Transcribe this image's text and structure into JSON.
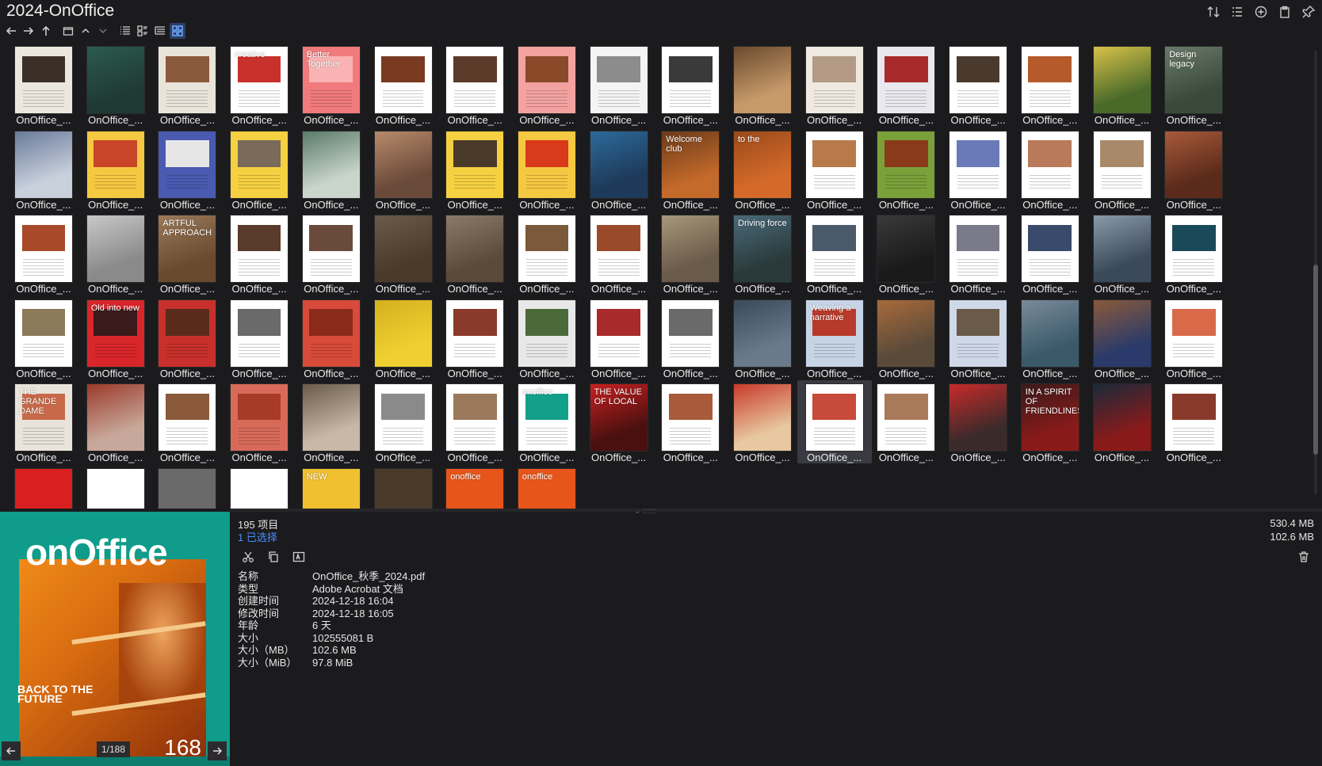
{
  "window": {
    "title": "2024-OnOffice"
  },
  "grid": {
    "item_label": "OnOffice_...",
    "columns": 17,
    "selected_index": 79,
    "items": [
      {
        "bg": "#ece7de",
        "pic": "#3b3028"
      },
      {
        "bg": "#1f3a33",
        "pic": "#2c5b4f",
        "full": true
      },
      {
        "bg": "#e9e4da",
        "pic": "#8a5a3c"
      },
      {
        "bg": "#ffffff",
        "pic": "#c8302c",
        "text": "creative"
      },
      {
        "bg": "#f07a7c",
        "pic": "#f9b3b2",
        "text": "Better Together"
      },
      {
        "bg": "#ffffff",
        "pic": "#7a3a22"
      },
      {
        "bg": "#ffffff",
        "pic": "#5b3a2a"
      },
      {
        "bg": "#f3a2a1",
        "pic": "#8a4a2a"
      },
      {
        "bg": "#f4f4f4",
        "pic": "#8c8c8c"
      },
      {
        "bg": "#ffffff",
        "pic": "#3a3a3a"
      },
      {
        "bg": "#c79a6a",
        "pic": "#6a4a2e",
        "full": true
      },
      {
        "bg": "#efe9e1",
        "pic": "#b39a86"
      },
      {
        "bg": "#e8e8ee",
        "pic": "#a92a2a"
      },
      {
        "bg": "#ffffff",
        "pic": "#4a3a2e"
      },
      {
        "bg": "#ffffff",
        "pic": "#b55a2a"
      },
      {
        "bg": "#4a6a2a",
        "pic": "#d8c14a",
        "full": true
      },
      {
        "bg": "#3a4a3a",
        "pic": "#6a7a6a",
        "full": true,
        "text": "Design legacy"
      },
      {
        "bg": "#c8d0dc",
        "pic": "#6a7a9a",
        "full": true
      },
      {
        "bg": "#f5c842",
        "pic": "#c8452a"
      },
      {
        "bg": "#4a5ab0",
        "pic": "#e6e6e6"
      },
      {
        "bg": "#f5d142",
        "pic": "#7a6a5a"
      },
      {
        "bg": "#cad6cc",
        "pic": "#5a7a6a",
        "full": true
      },
      {
        "bg": "#6a4a3a",
        "pic": "#b88a6a",
        "full": true
      },
      {
        "bg": "#f5d142",
        "pic": "#4a3a2a"
      },
      {
        "bg": "#f5c842",
        "pic": "#d83a1a"
      },
      {
        "bg": "#1e3a5a",
        "pic": "#2c6a9a",
        "full": true
      },
      {
        "bg": "#c46a2a",
        "pic": "#6a3a1a",
        "full": true,
        "text": "Welcome club"
      },
      {
        "bg": "#d46a2a",
        "pic": "#9a4a1a",
        "full": true,
        "text": "to the"
      },
      {
        "bg": "#ffffff",
        "pic": "#b87a4a"
      },
      {
        "bg": "#7aa03a",
        "pic": "#8a3a1a"
      },
      {
        "bg": "#ffffff",
        "pic": "#6a7ab8"
      },
      {
        "bg": "#ffffff",
        "pic": "#b87a5a"
      },
      {
        "bg": "#ffffff",
        "pic": "#a88a6a"
      },
      {
        "bg": "#5a2a1a",
        "pic": "#a85a3a",
        "full": true
      },
      {
        "bg": "#ffffff",
        "pic": "#a84a2a"
      },
      {
        "bg": "#8a8a8a",
        "pic": "#c8c8c8",
        "full": true
      },
      {
        "bg": "#6a4a2e",
        "pic": "#9a7a5a",
        "full": true,
        "text": "ARTFUL APPROACH"
      },
      {
        "bg": "#ffffff",
        "pic": "#5a3a2a"
      },
      {
        "bg": "#ffffff",
        "pic": "#6a4a3a"
      },
      {
        "bg": "#4a3a2a",
        "pic": "#6a5a4a",
        "full": true
      },
      {
        "bg": "#5a4a3a",
        "pic": "#8a7a6a",
        "full": true
      },
      {
        "bg": "#ffffff",
        "pic": "#7a5a3a"
      },
      {
        "bg": "#ffffff",
        "pic": "#9a4a2a"
      },
      {
        "bg": "#6a5a4a",
        "pic": "#a8987a",
        "full": true
      },
      {
        "bg": "#2a3a3a",
        "pic": "#4a6a7a",
        "full": true,
        "text": "Driving force"
      },
      {
        "bg": "#ffffff",
        "pic": "#4a5a6a"
      },
      {
        "bg": "#1a1a1a",
        "pic": "#3a3a3a",
        "full": true
      },
      {
        "bg": "#ffffff",
        "pic": "#7a7a8a"
      },
      {
        "bg": "#ffffff",
        "pic": "#3a4a6a"
      },
      {
        "bg": "#3a4a5a",
        "pic": "#8a9aaa",
        "full": true
      },
      {
        "bg": "#ffffff",
        "pic": "#1a4a5a"
      },
      {
        "bg": "#ffffff",
        "pic": "#8a7a5a"
      },
      {
        "bg": "#d8262a",
        "pic": "#3a1a1a",
        "text": "Old into new"
      },
      {
        "bg": "#c8302c",
        "pic": "#5a2a1a"
      },
      {
        "bg": "#ffffff",
        "pic": "#6a6a6a"
      },
      {
        "bg": "#d84a3a",
        "pic": "#8a2a1a"
      },
      {
        "bg": "#f0d030",
        "pic": "#d4b020",
        "full": true
      },
      {
        "bg": "#ffffff",
        "pic": "#8a3a2a"
      },
      {
        "bg": "#e8e8e8",
        "pic": "#4a6a3a"
      },
      {
        "bg": "#ffffff",
        "pic": "#a82a2a"
      },
      {
        "bg": "#ffffff",
        "pic": "#6a6a6a"
      },
      {
        "bg": "#6a7a8a",
        "pic": "#3a4a5a",
        "full": true
      },
      {
        "bg": "#c6d4e6",
        "pic": "#b83a2a",
        "text": "Weaving a narrative"
      },
      {
        "bg": "#5a4a3a",
        "pic": "#a86a3a",
        "full": true
      },
      {
        "bg": "#cfd8e8",
        "pic": "#6a5a4a"
      },
      {
        "bg": "#3a5a6a",
        "pic": "#7a8a9a",
        "full": true
      },
      {
        "bg": "#2a3a6a",
        "pic": "#8a5a3a",
        "full": true
      },
      {
        "bg": "#ffffff",
        "pic": "#d86a4a"
      },
      {
        "bg": "#e8e4dc",
        "pic": "#c86a4a",
        "text": "THE GRANDE DAME"
      },
      {
        "bg": "#c8a89a",
        "pic": "#9a3a2a",
        "full": true
      },
      {
        "bg": "#ffffff",
        "pic": "#8a5a3a"
      },
      {
        "bg": "#d86a5a",
        "pic": "#a83a2a"
      },
      {
        "bg": "#c8b8a8",
        "pic": "#6a5a4a",
        "full": true
      },
      {
        "bg": "#ffffff",
        "pic": "#8a8a8a"
      },
      {
        "bg": "#ffffff",
        "pic": "#9a7a5a"
      },
      {
        "bg": "#ffffff",
        "pic": "#13a08a",
        "text": "onoffice"
      },
      {
        "bg": "#4a1010",
        "pic": "#c82020",
        "full": true,
        "text": "THE VALUE OF LOCAL"
      },
      {
        "bg": "#ffffff",
        "pic": "#a85a3a"
      },
      {
        "bg": "#e8c8a0",
        "pic": "#c83a2a",
        "full": true
      },
      {
        "bg": "#ffffff",
        "pic": "#c84a3a"
      },
      {
        "bg": "#ffffff",
        "pic": "#a87a5a"
      },
      {
        "bg": "#3a2a2a",
        "pic": "#c82a2a",
        "full": true
      },
      {
        "bg": "#8a1a1a",
        "pic": "#3a1a1a",
        "full": true,
        "text": "IN A SPIRIT OF FRIENDLINESS"
      },
      {
        "bg": "#8a1a1a",
        "pic": "#1a2a3a",
        "full": true
      },
      {
        "bg": "#ffffff",
        "pic": "#8a3a2a"
      }
    ],
    "partial_row": [
      {
        "bg": "#d82020"
      },
      {
        "bg": "#ffffff"
      },
      {
        "bg": "#6a6a6a"
      },
      {
        "bg": "#ffffff"
      },
      {
        "bg": "#f0c030",
        "text": "NEW"
      },
      {
        "bg": "#4a3a2a"
      },
      {
        "bg": "#e8551a",
        "text": "onoffice"
      },
      {
        "bg": "#e8551a",
        "text": "onoffice"
      }
    ]
  },
  "status": {
    "count": "195 项目",
    "selected": "1 已选择",
    "total_size": "530.4 MB",
    "selected_size": "102.6 MB"
  },
  "preview": {
    "logo": "onOffice",
    "tagline": "BACK TO THE FUTURE",
    "issue": "168",
    "page_indicator": "1/188"
  },
  "properties": [
    {
      "k": "名称",
      "v": "OnOffice_秋季_2024.pdf"
    },
    {
      "k": "类型",
      "v": "Adobe Acrobat 文档"
    },
    {
      "k": "创建时间",
      "v": "2024-12-18  16:04"
    },
    {
      "k": "修改时间",
      "v": "2024-12-18  16:05"
    },
    {
      "k": "年龄",
      "v": "6 天"
    },
    {
      "k": "大小",
      "v": "102555081 B"
    },
    {
      "k": "大小（MB）",
      "v": "102.6 MB"
    },
    {
      "k": "大小（MiB）",
      "v": "97.8 MiB"
    }
  ]
}
